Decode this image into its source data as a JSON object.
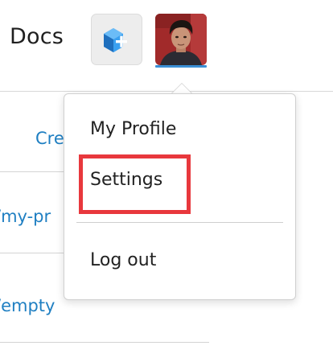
{
  "header": {
    "title": "Docs",
    "new_doc_button_icon": "new-document-icon",
    "avatar_icon": "user-avatar"
  },
  "background_list": {
    "rows": [
      {
        "link_text": "Cre"
      },
      {
        "link_text": "/my-pr"
      },
      {
        "link_text": "/empty"
      }
    ]
  },
  "user_menu": {
    "items": [
      {
        "label": "My Profile"
      },
      {
        "label": "Settings"
      },
      {
        "label": "Log out"
      }
    ],
    "highlighted_item": "Settings"
  },
  "colors": {
    "accent": "#3a8fd6",
    "link": "#1f7fc2",
    "highlight": "#e8383d",
    "icon_blue": "#2f8fe0"
  }
}
